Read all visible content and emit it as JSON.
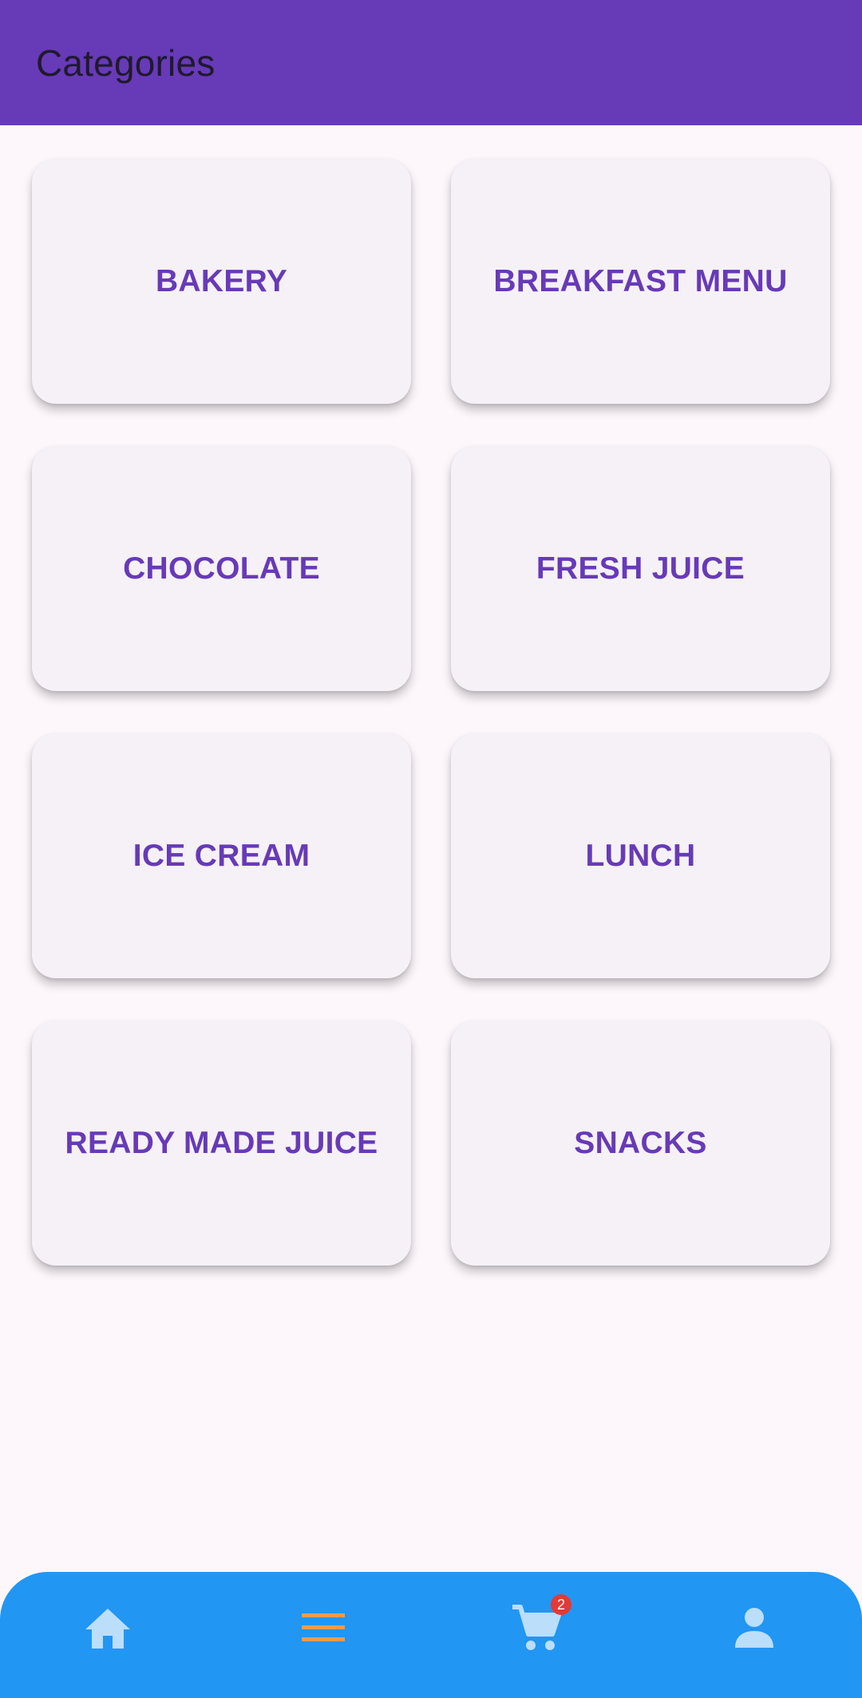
{
  "appbar": {
    "title": "Categories",
    "background_color": "#673ab7"
  },
  "categories": [
    {
      "label": "BAKERY"
    },
    {
      "label": "BREAKFAST MENU"
    },
    {
      "label": "CHOCOLATE"
    },
    {
      "label": "FRESH JUICE"
    },
    {
      "label": "ICE CREAM"
    },
    {
      "label": "LUNCH"
    },
    {
      "label": "READY MADE JUICE"
    },
    {
      "label": "SNACKS"
    }
  ],
  "bottom_nav": {
    "background_color": "#2196f3",
    "items": [
      {
        "icon": "home-icon",
        "active": false
      },
      {
        "icon": "menu-icon",
        "active": true
      },
      {
        "icon": "cart-icon",
        "active": false,
        "badge": "2"
      },
      {
        "icon": "person-icon",
        "active": false
      }
    ],
    "icon_color": "#bbdefb",
    "active_icon_color": "#f39a4e",
    "badge_color": "#e53935"
  }
}
